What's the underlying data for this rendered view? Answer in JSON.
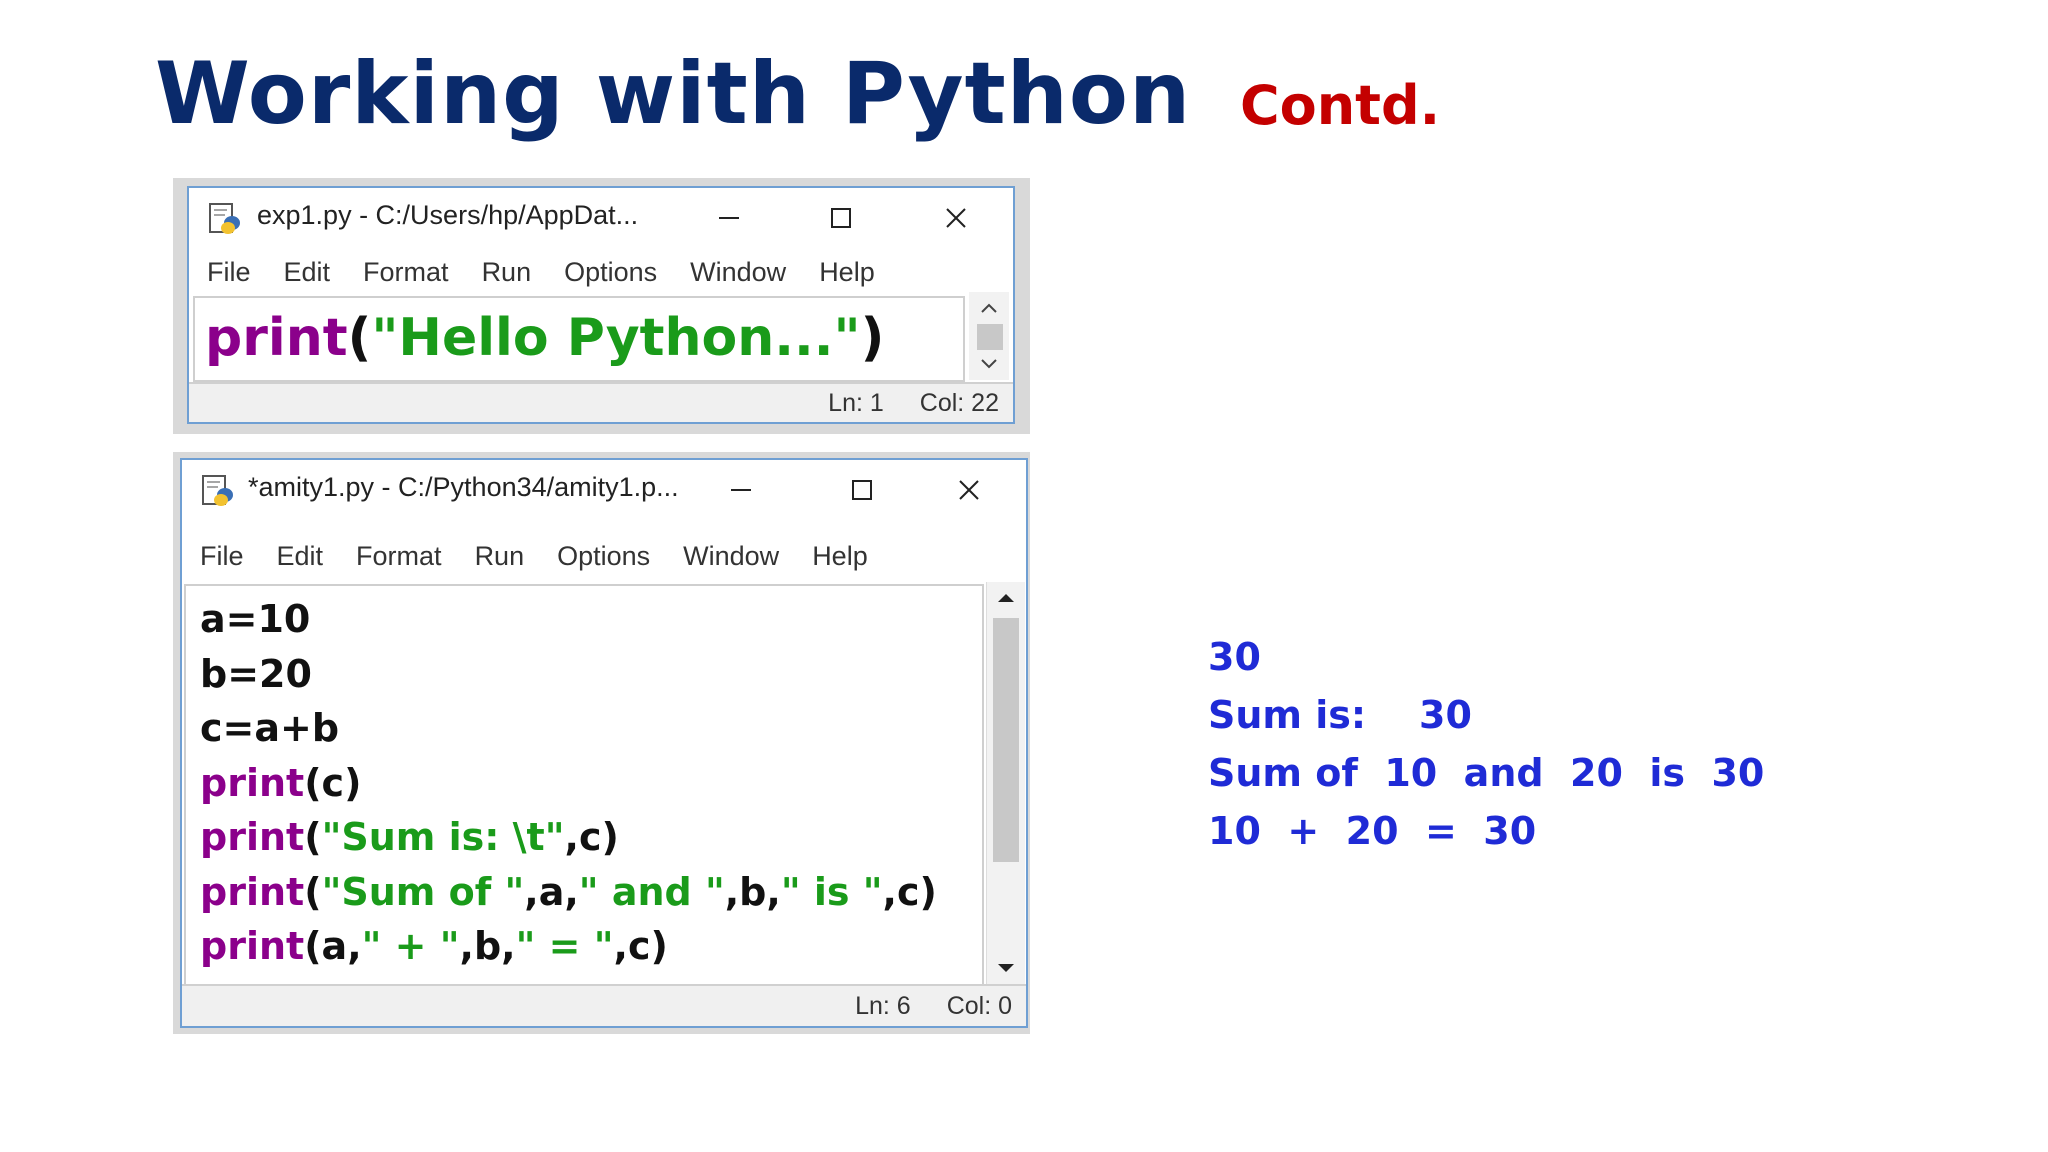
{
  "slide": {
    "title": "Working with Python",
    "subtitle": "Contd."
  },
  "window1": {
    "title": "exp1.py - C:/Users/hp/AppDat...",
    "menu": [
      "File",
      "Edit",
      "Format",
      "Run",
      "Options",
      "Window",
      "Help"
    ],
    "code_kw": "print",
    "code_open": "(",
    "code_str": "\"Hello Python...\"",
    "code_close": ")",
    "status": {
      "ln": "Ln: 1",
      "col": "Col: 22"
    }
  },
  "window2": {
    "title": "*amity1.py - C:/Python34/amity1.p...",
    "menu": [
      "File",
      "Edit",
      "Format",
      "Run",
      "Options",
      "Window",
      "Help"
    ],
    "code": {
      "l1": "a=10",
      "l2": "b=20",
      "l3": "c=a+b",
      "l4": {
        "kw": "print",
        "rest": "(c)"
      },
      "l5": {
        "kw": "print",
        "p1": "(",
        "s1": "\"Sum is: \\t\"",
        "rest": ",c)"
      },
      "l6": {
        "kw": "print",
        "p1": "(",
        "s1": "\"Sum of \"",
        "p2": ",a,",
        "s2": "\" and \"",
        "p3": ",b,",
        "s3": "\" is \"",
        "rest": ",c)"
      },
      "l7": {
        "kw": "print",
        "p1": "(a,",
        "s1": "\" + \"",
        "p2": ",b,",
        "s2": "\" = \"",
        "rest": ",c)"
      }
    },
    "status": {
      "ln": "Ln: 6",
      "col": "Col: 0"
    }
  },
  "output": [
    "30",
    "Sum is:    30",
    "Sum of  10  and  20  is  30",
    "10  +  20  =  30"
  ],
  "colors": {
    "title": "#0a2a6b",
    "subtitle": "#c40000",
    "keyword": "#8b008b",
    "string": "#1a9b1a",
    "output": "#1f2bd6",
    "window_border": "#6f9fd3"
  },
  "icons": [
    "python-file-icon",
    "minimize-icon",
    "maximize-icon",
    "close-icon",
    "scroll-up-icon",
    "scroll-down-icon"
  ]
}
